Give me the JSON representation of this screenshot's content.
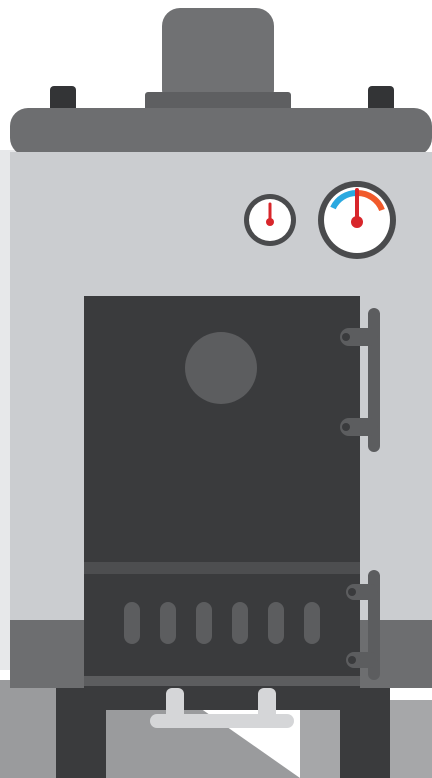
{
  "image": {
    "subject": "boiler",
    "colors": {
      "background": "#ffffff",
      "backdrop": "#e7e8ea",
      "body": "#cbcdd0",
      "top_cap": "#6d6e70",
      "chimney": "#707173",
      "door": "#3a3b3d",
      "handle": "#5c5d5f",
      "legs": "#3a3b3d",
      "base": "#6d6e70",
      "floor": "#9a9b9d",
      "gauge_ring": "#4a4b4d",
      "gauge_face": "#ffffff",
      "needle": "#d8262b",
      "arc_cool": "#2aa9e0",
      "arc_hot": "#f15a2b"
    },
    "parts": {
      "chimney": "chimney-stack",
      "gauge_small": "thermometer-gauge",
      "gauge_large": "pressure-gauge",
      "firebox_door": "firebox-door",
      "ash_pan": "ash-pan-door",
      "vent_slots": 6
    }
  }
}
